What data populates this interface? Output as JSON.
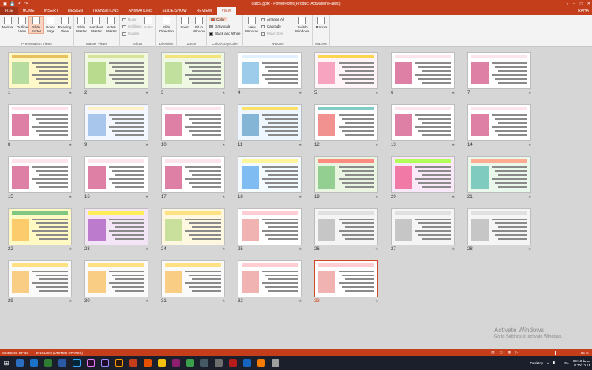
{
  "titlebar": {
    "title": "darc5.pptx - PowerPoint (Product Activation Failed)",
    "controls": [
      "?",
      "–",
      "□",
      "✕"
    ]
  },
  "tabs": [
    {
      "label": "FILE",
      "active": false
    },
    {
      "label": "HOME",
      "active": false
    },
    {
      "label": "INSERT",
      "active": false
    },
    {
      "label": "DESIGN",
      "active": false
    },
    {
      "label": "TRANSITIONS",
      "active": false
    },
    {
      "label": "ANIMATIONS",
      "active": false
    },
    {
      "label": "SLIDE SHOW",
      "active": false
    },
    {
      "label": "REVIEW",
      "active": false
    },
    {
      "label": "VIEW",
      "active": true
    }
  ],
  "user": "RAHA",
  "ribbon": {
    "presentation_views": {
      "label": "Presentation Views",
      "buttons": [
        "Normal",
        "Outline View",
        "Slide Sorter",
        "Notes Page",
        "Reading View"
      ]
    },
    "master_views": {
      "label": "Master Views",
      "buttons": [
        "Slide Master",
        "Handout Master",
        "Notes Master"
      ]
    },
    "show": {
      "label": "Show",
      "items": [
        "Ruler",
        "Gridlines",
        "Guides"
      ],
      "notes": "Notes"
    },
    "direction": {
      "label": "Direction",
      "button": "Slide Direction"
    },
    "zoom": {
      "label": "Zoom",
      "buttons": [
        "Zoom",
        "Fit to Window"
      ]
    },
    "color": {
      "label": "Color/Grayscale",
      "items": [
        "Color",
        "Grayscale",
        "Black and White"
      ]
    },
    "window": {
      "label": "Window",
      "new_window": "New Window",
      "items": [
        "Arrange All",
        "Cascade",
        "Move Split"
      ],
      "switch": "Switch Windows"
    },
    "macros": {
      "label": "Macros",
      "button": "Macros"
    }
  },
  "slides": [
    "1",
    "2",
    "3",
    "4",
    "5",
    "6",
    "7",
    "8",
    "9",
    "10",
    "11",
    "12",
    "13",
    "14",
    "15",
    "16",
    "17",
    "18",
    "19",
    "20",
    "21",
    "22",
    "23",
    "24",
    "25",
    "26",
    "27",
    "28",
    "29",
    "30",
    "31",
    "32",
    "33"
  ],
  "selected_slide": "33",
  "activate": {
    "line1": "Activate Windows",
    "line2": "Go to Settings to activate Windows."
  },
  "status": {
    "slide": "SLIDE 33 OF 33",
    "language": "ENGLISH (UNITED STATES)",
    "zoom": "66 %",
    "zoom_level": 0.66
  },
  "taskbar": {
    "desktop": "Desktop",
    "lang": "FA",
    "time": "09:13 ب.ظ",
    "date": "۱۳۹۹/۰۹/۱۷"
  }
}
